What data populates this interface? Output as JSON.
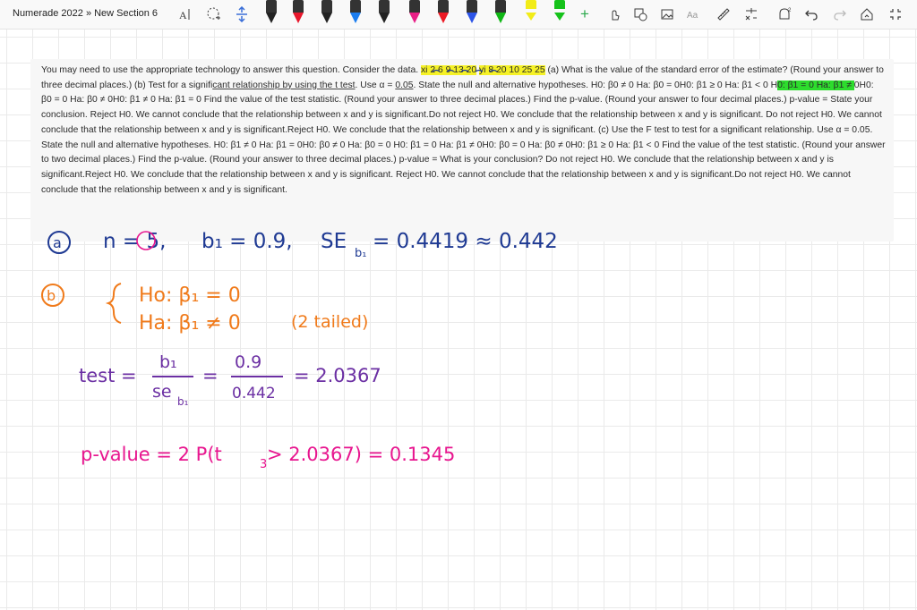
{
  "app": {
    "title": "Numerade 2022 » New Section 6"
  },
  "toolbar": {
    "pens": [
      {
        "color": "#222222"
      },
      {
        "color": "#e8162b"
      },
      {
        "color": "#222222"
      },
      {
        "color": "#1b7df0"
      },
      {
        "color": "#222222"
      },
      {
        "color": "#e81f86",
        "selected": true
      },
      {
        "color": "#ec1a24"
      },
      {
        "color": "#2c54e8"
      },
      {
        "color": "#11b816"
      },
      {
        "color": "#f2ec18"
      },
      {
        "color": "#16c21b"
      }
    ],
    "icons": [
      "type-icon",
      "lasso-icon",
      "insert-space-icon",
      "add-icon",
      "touch-icon",
      "shape-icon",
      "image-icon",
      "ink-to-text-icon",
      "ruler-icon",
      "math-icon",
      "zoom-icon",
      "undo-icon",
      "redo-icon",
      "replay-icon",
      "fullscreen-icon"
    ]
  },
  "question": {
    "segments": [
      {
        "t": "You may need to use the appropriate technology to answer this question. Consider the data. "
      },
      {
        "t": "xi 2 6 9 13 20",
        "hl": "yellow"
      },
      {
        "t": " "
      },
      {
        "t": "yi 8 20 10 25 25",
        "hl": "yellow"
      },
      {
        "t": " (a) What is the value of the standard error of the estimate? (Round your answer to three decimal places.) (b) Test for a signifi"
      },
      {
        "t": "cant relationship by using the t test",
        "ul": true
      },
      {
        "t": ". Use α = "
      },
      {
        "t": "0.05",
        "ul": true
      },
      {
        "t": ". State the null and alternative hypotheses. H0: β0 ≠ 0 Ha: β0 = 0H0: β1 ≥ 0 Ha: β1 < 0 H"
      },
      {
        "t": "0: β1 = 0 Ha: β1 ≠ ",
        "hl": "green"
      },
      {
        "t": "0H0: β0 = 0 Ha: β0 ≠ 0H0: β1 ≠ 0 Ha: β1 = 0 Find the value of the test statistic. (Round your answer to three decimal places.) Find the p-value. (Round your answer to four decimal places.) p-value = State your conclusion. Reject H0. We cannot conclude that the relationship between x and y is significant.Do not reject H0. We conclude that the relationship between x and y is significant. Do not reject H0. We cannot conclude that the relationship between x and y is significant.Reject H0. We conclude that the relationship between x and y is significant. (c) Use the F test to test for a significant relationship. Use α = 0.05. State the null and alternative hypotheses. H0: β1 ≠ 0 Ha: β1 = 0H0: β0 ≠ 0 Ha: β0 = 0 H0: β1 = 0 Ha: β1 ≠ 0H0: β0 = 0 Ha: β0 ≠ 0H0: β1 ≥ 0 Ha: β1 < 0 Find the value of the test statistic. (Round your answer to two decimal places.) Find the p-value. (Round your answer to three decimal places.) p-value = What is your conclusion? Do not reject H0. We conclude that the relationship between x and y is significant.Reject H0. We conclude that the relationship between x and y is significant. Reject H0. We cannot conclude that the relationship between x and y is significant.Do not reject H0. We cannot conclude that the relationship between x and y is significant."
      }
    ]
  },
  "notes": {
    "part_a": {
      "label": "a",
      "n_text": "n = 5,",
      "n_value": "5",
      "b1_text": "b₁ = 0.9,",
      "se_text": "SE",
      "se_sub": "b₁",
      "se_value": "= 0.4419 ≈ 0.442"
    },
    "part_b": {
      "label": "b",
      "h0": "Ho:  β₁ = 0",
      "ha": "Ha:  β₁ ≠ 0",
      "tail_note": "(2 tailed)",
      "test_lhs": "test =",
      "frac1_num": "b₁",
      "frac1_den": "se",
      "frac1_den_sub": "b₁",
      "eq1": "=",
      "frac2_num": "0.9",
      "frac2_den": "0.442",
      "result": "= 2.0367",
      "pvalue_text": "p-value = 2 P(t",
      "pvalue_sub": "3",
      "pvalue_rest": " > 2.0367) = 0.1345"
    },
    "colors": {
      "blue_ink": "#1f3a93",
      "orange_ink": "#f07a1a",
      "purple_ink": "#6b2fa3",
      "pink_ink": "#e8168f"
    }
  }
}
